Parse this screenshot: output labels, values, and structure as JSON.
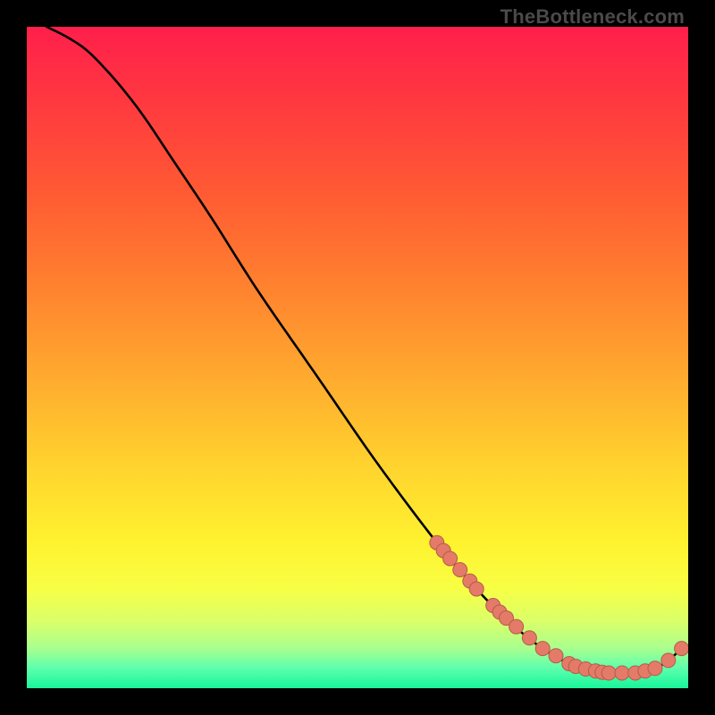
{
  "watermark": "TheBottleneck.com",
  "colors": {
    "bg": "#000000",
    "gradient_stops": [
      {
        "offset": 0.0,
        "color": "#ff1f4b"
      },
      {
        "offset": 0.12,
        "color": "#ff3a3f"
      },
      {
        "offset": 0.25,
        "color": "#ff5a33"
      },
      {
        "offset": 0.38,
        "color": "#ff7e2f"
      },
      {
        "offset": 0.52,
        "color": "#ffa72f"
      },
      {
        "offset": 0.66,
        "color": "#ffd22e"
      },
      {
        "offset": 0.78,
        "color": "#fff22f"
      },
      {
        "offset": 0.85,
        "color": "#f7ff45"
      },
      {
        "offset": 0.9,
        "color": "#d9ff6a"
      },
      {
        "offset": 0.94,
        "color": "#a8ff8f"
      },
      {
        "offset": 0.97,
        "color": "#5dffad"
      },
      {
        "offset": 1.0,
        "color": "#17f59a"
      }
    ],
    "curve": "#000000",
    "marker_fill": "#e37b68",
    "marker_stroke": "#b85a49"
  },
  "chart_data": {
    "type": "line",
    "title": "",
    "xlabel": "",
    "ylabel": "",
    "xlim": [
      0,
      100
    ],
    "ylim": [
      0,
      100
    ],
    "grid": false,
    "curve": [
      {
        "x": 3,
        "y": 100
      },
      {
        "x": 6,
        "y": 98.5
      },
      {
        "x": 9,
        "y": 96.5
      },
      {
        "x": 12,
        "y": 93.5
      },
      {
        "x": 15,
        "y": 90
      },
      {
        "x": 18,
        "y": 86
      },
      {
        "x": 22,
        "y": 80
      },
      {
        "x": 28,
        "y": 71
      },
      {
        "x": 35,
        "y": 60
      },
      {
        "x": 44,
        "y": 47
      },
      {
        "x": 53,
        "y": 34
      },
      {
        "x": 62,
        "y": 22
      },
      {
        "x": 68,
        "y": 15
      },
      {
        "x": 73,
        "y": 10
      },
      {
        "x": 78,
        "y": 6
      },
      {
        "x": 83,
        "y": 3.3
      },
      {
        "x": 88,
        "y": 2.3
      },
      {
        "x": 92,
        "y": 2.3
      },
      {
        "x": 95,
        "y": 3.0
      },
      {
        "x": 97,
        "y": 4.2
      },
      {
        "x": 99,
        "y": 6.0
      }
    ],
    "markers": [
      {
        "x": 62,
        "y": 22
      },
      {
        "x": 63,
        "y": 20.8
      },
      {
        "x": 64,
        "y": 19.6
      },
      {
        "x": 65.5,
        "y": 17.9
      },
      {
        "x": 67,
        "y": 16.2
      },
      {
        "x": 68,
        "y": 15
      },
      {
        "x": 70.5,
        "y": 12.5
      },
      {
        "x": 71.5,
        "y": 11.5
      },
      {
        "x": 72.5,
        "y": 10.6
      },
      {
        "x": 74,
        "y": 9.3
      },
      {
        "x": 76,
        "y": 7.6
      },
      {
        "x": 78,
        "y": 6
      },
      {
        "x": 80,
        "y": 4.9
      },
      {
        "x": 82,
        "y": 3.7
      },
      {
        "x": 83,
        "y": 3.3
      },
      {
        "x": 84.5,
        "y": 2.9
      },
      {
        "x": 86,
        "y": 2.6
      },
      {
        "x": 87,
        "y": 2.4
      },
      {
        "x": 88,
        "y": 2.3
      },
      {
        "x": 90,
        "y": 2.3
      },
      {
        "x": 92,
        "y": 2.3
      },
      {
        "x": 93.5,
        "y": 2.6
      },
      {
        "x": 95,
        "y": 3.0
      },
      {
        "x": 97,
        "y": 4.2
      },
      {
        "x": 99,
        "y": 6.0
      }
    ]
  }
}
